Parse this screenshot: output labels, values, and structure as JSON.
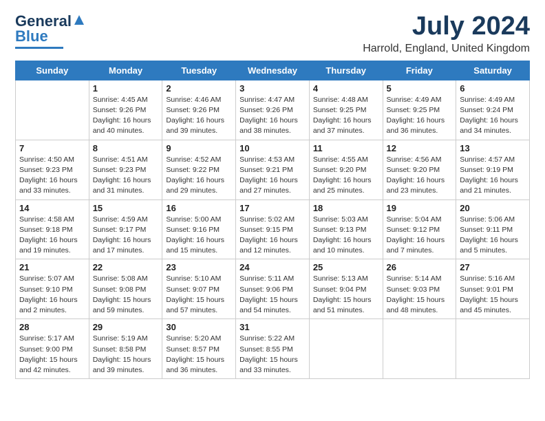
{
  "header": {
    "logo_general": "General",
    "logo_blue": "Blue",
    "month": "July 2024",
    "location": "Harrold, England, United Kingdom"
  },
  "weekdays": [
    "Sunday",
    "Monday",
    "Tuesday",
    "Wednesday",
    "Thursday",
    "Friday",
    "Saturday"
  ],
  "weeks": [
    [
      {
        "day": "",
        "info": ""
      },
      {
        "day": "1",
        "info": "Sunrise: 4:45 AM\nSunset: 9:26 PM\nDaylight: 16 hours\nand 40 minutes."
      },
      {
        "day": "2",
        "info": "Sunrise: 4:46 AM\nSunset: 9:26 PM\nDaylight: 16 hours\nand 39 minutes."
      },
      {
        "day": "3",
        "info": "Sunrise: 4:47 AM\nSunset: 9:26 PM\nDaylight: 16 hours\nand 38 minutes."
      },
      {
        "day": "4",
        "info": "Sunrise: 4:48 AM\nSunset: 9:25 PM\nDaylight: 16 hours\nand 37 minutes."
      },
      {
        "day": "5",
        "info": "Sunrise: 4:49 AM\nSunset: 9:25 PM\nDaylight: 16 hours\nand 36 minutes."
      },
      {
        "day": "6",
        "info": "Sunrise: 4:49 AM\nSunset: 9:24 PM\nDaylight: 16 hours\nand 34 minutes."
      }
    ],
    [
      {
        "day": "7",
        "info": "Sunrise: 4:50 AM\nSunset: 9:23 PM\nDaylight: 16 hours\nand 33 minutes."
      },
      {
        "day": "8",
        "info": "Sunrise: 4:51 AM\nSunset: 9:23 PM\nDaylight: 16 hours\nand 31 minutes."
      },
      {
        "day": "9",
        "info": "Sunrise: 4:52 AM\nSunset: 9:22 PM\nDaylight: 16 hours\nand 29 minutes."
      },
      {
        "day": "10",
        "info": "Sunrise: 4:53 AM\nSunset: 9:21 PM\nDaylight: 16 hours\nand 27 minutes."
      },
      {
        "day": "11",
        "info": "Sunrise: 4:55 AM\nSunset: 9:20 PM\nDaylight: 16 hours\nand 25 minutes."
      },
      {
        "day": "12",
        "info": "Sunrise: 4:56 AM\nSunset: 9:20 PM\nDaylight: 16 hours\nand 23 minutes."
      },
      {
        "day": "13",
        "info": "Sunrise: 4:57 AM\nSunset: 9:19 PM\nDaylight: 16 hours\nand 21 minutes."
      }
    ],
    [
      {
        "day": "14",
        "info": "Sunrise: 4:58 AM\nSunset: 9:18 PM\nDaylight: 16 hours\nand 19 minutes."
      },
      {
        "day": "15",
        "info": "Sunrise: 4:59 AM\nSunset: 9:17 PM\nDaylight: 16 hours\nand 17 minutes."
      },
      {
        "day": "16",
        "info": "Sunrise: 5:00 AM\nSunset: 9:16 PM\nDaylight: 16 hours\nand 15 minutes."
      },
      {
        "day": "17",
        "info": "Sunrise: 5:02 AM\nSunset: 9:15 PM\nDaylight: 16 hours\nand 12 minutes."
      },
      {
        "day": "18",
        "info": "Sunrise: 5:03 AM\nSunset: 9:13 PM\nDaylight: 16 hours\nand 10 minutes."
      },
      {
        "day": "19",
        "info": "Sunrise: 5:04 AM\nSunset: 9:12 PM\nDaylight: 16 hours\nand 7 minutes."
      },
      {
        "day": "20",
        "info": "Sunrise: 5:06 AM\nSunset: 9:11 PM\nDaylight: 16 hours\nand 5 minutes."
      }
    ],
    [
      {
        "day": "21",
        "info": "Sunrise: 5:07 AM\nSunset: 9:10 PM\nDaylight: 16 hours\nand 2 minutes."
      },
      {
        "day": "22",
        "info": "Sunrise: 5:08 AM\nSunset: 9:08 PM\nDaylight: 15 hours\nand 59 minutes."
      },
      {
        "day": "23",
        "info": "Sunrise: 5:10 AM\nSunset: 9:07 PM\nDaylight: 15 hours\nand 57 minutes."
      },
      {
        "day": "24",
        "info": "Sunrise: 5:11 AM\nSunset: 9:06 PM\nDaylight: 15 hours\nand 54 minutes."
      },
      {
        "day": "25",
        "info": "Sunrise: 5:13 AM\nSunset: 9:04 PM\nDaylight: 15 hours\nand 51 minutes."
      },
      {
        "day": "26",
        "info": "Sunrise: 5:14 AM\nSunset: 9:03 PM\nDaylight: 15 hours\nand 48 minutes."
      },
      {
        "day": "27",
        "info": "Sunrise: 5:16 AM\nSunset: 9:01 PM\nDaylight: 15 hours\nand 45 minutes."
      }
    ],
    [
      {
        "day": "28",
        "info": "Sunrise: 5:17 AM\nSunset: 9:00 PM\nDaylight: 15 hours\nand 42 minutes."
      },
      {
        "day": "29",
        "info": "Sunrise: 5:19 AM\nSunset: 8:58 PM\nDaylight: 15 hours\nand 39 minutes."
      },
      {
        "day": "30",
        "info": "Sunrise: 5:20 AM\nSunset: 8:57 PM\nDaylight: 15 hours\nand 36 minutes."
      },
      {
        "day": "31",
        "info": "Sunrise: 5:22 AM\nSunset: 8:55 PM\nDaylight: 15 hours\nand 33 minutes."
      },
      {
        "day": "",
        "info": ""
      },
      {
        "day": "",
        "info": ""
      },
      {
        "day": "",
        "info": ""
      }
    ]
  ]
}
